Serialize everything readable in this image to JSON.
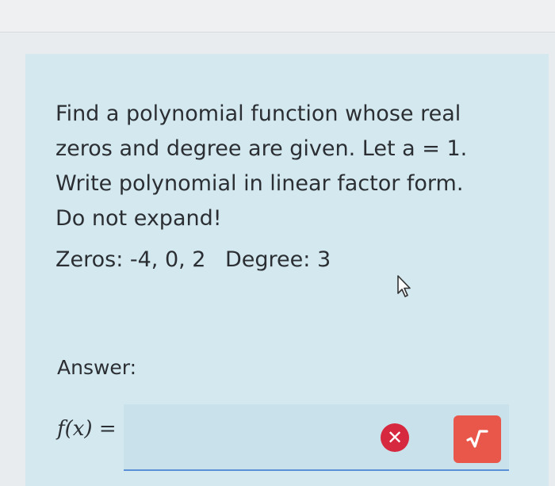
{
  "question": {
    "text": "Find a polynomial function whose real zeros and degree are given. Let a = 1. Write polynomial in linear factor form. Do not expand!",
    "zeros": "Zeros: -4, 0, 2",
    "degree": "Degree: 3"
  },
  "answer": {
    "label": "Answer:",
    "fx_label": "f(x)",
    "equals": " =",
    "input_value": "",
    "clear_symbol": "✕",
    "submit_icon": "square-root-icon"
  },
  "colors": {
    "card_bg": "#d3e8ef",
    "clear_button": "#d6283f",
    "submit_button": "#e8574a",
    "input_underline": "#5b8fd6"
  }
}
